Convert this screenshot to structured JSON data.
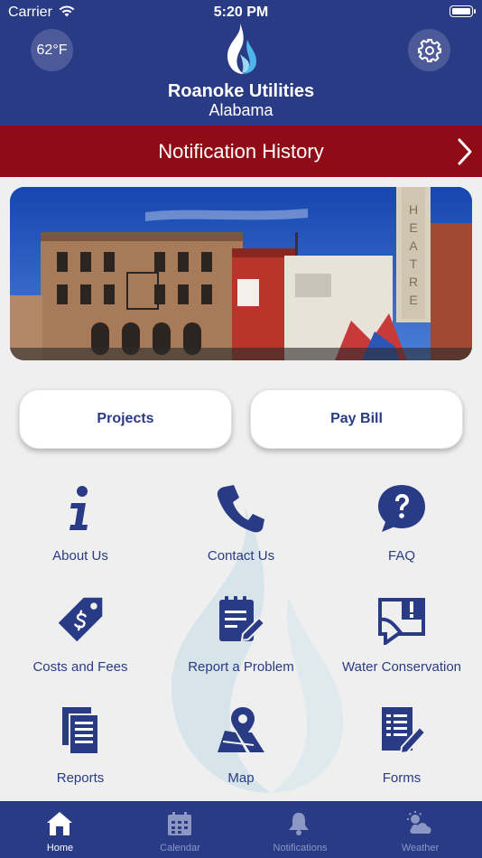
{
  "status_bar": {
    "carrier": "Carrier",
    "time": "5:20 PM"
  },
  "header": {
    "temperature": "62°F",
    "brand_name": "Roanoke Utilities",
    "brand_location": "Alabama",
    "settings_icon": "gear-icon"
  },
  "notification_bar": {
    "title": "Notification History",
    "icon": "chevron-right-icon"
  },
  "action_buttons": {
    "projects": "Projects",
    "pay_bill": "Pay Bill"
  },
  "menu_grid": [
    {
      "label": "About Us",
      "icon": "info-icon"
    },
    {
      "label": "Contact Us",
      "icon": "phone-icon"
    },
    {
      "label": "FAQ",
      "icon": "question-bubble-icon"
    },
    {
      "label": "Costs and Fees",
      "icon": "price-tag-icon"
    },
    {
      "label": "Report a Problem",
      "icon": "edit-note-icon"
    },
    {
      "label": "Water Conservation",
      "icon": "alert-map-icon"
    },
    {
      "label": "Reports",
      "icon": "documents-icon"
    },
    {
      "label": "Map",
      "icon": "map-pin-icon"
    },
    {
      "label": "Forms",
      "icon": "form-edit-icon"
    }
  ],
  "tab_bar": [
    {
      "label": "Home",
      "icon": "home-icon",
      "active": true
    },
    {
      "label": "Calendar",
      "icon": "calendar-icon",
      "active": false
    },
    {
      "label": "Notifications",
      "icon": "bell-icon",
      "active": false
    },
    {
      "label": "Weather",
      "icon": "weather-icon",
      "active": false
    }
  ],
  "colors": {
    "primary": "#2a3b86",
    "notification_red": "#8f0c16",
    "background": "#efefef",
    "tab_inactive": "#8c97c4"
  }
}
